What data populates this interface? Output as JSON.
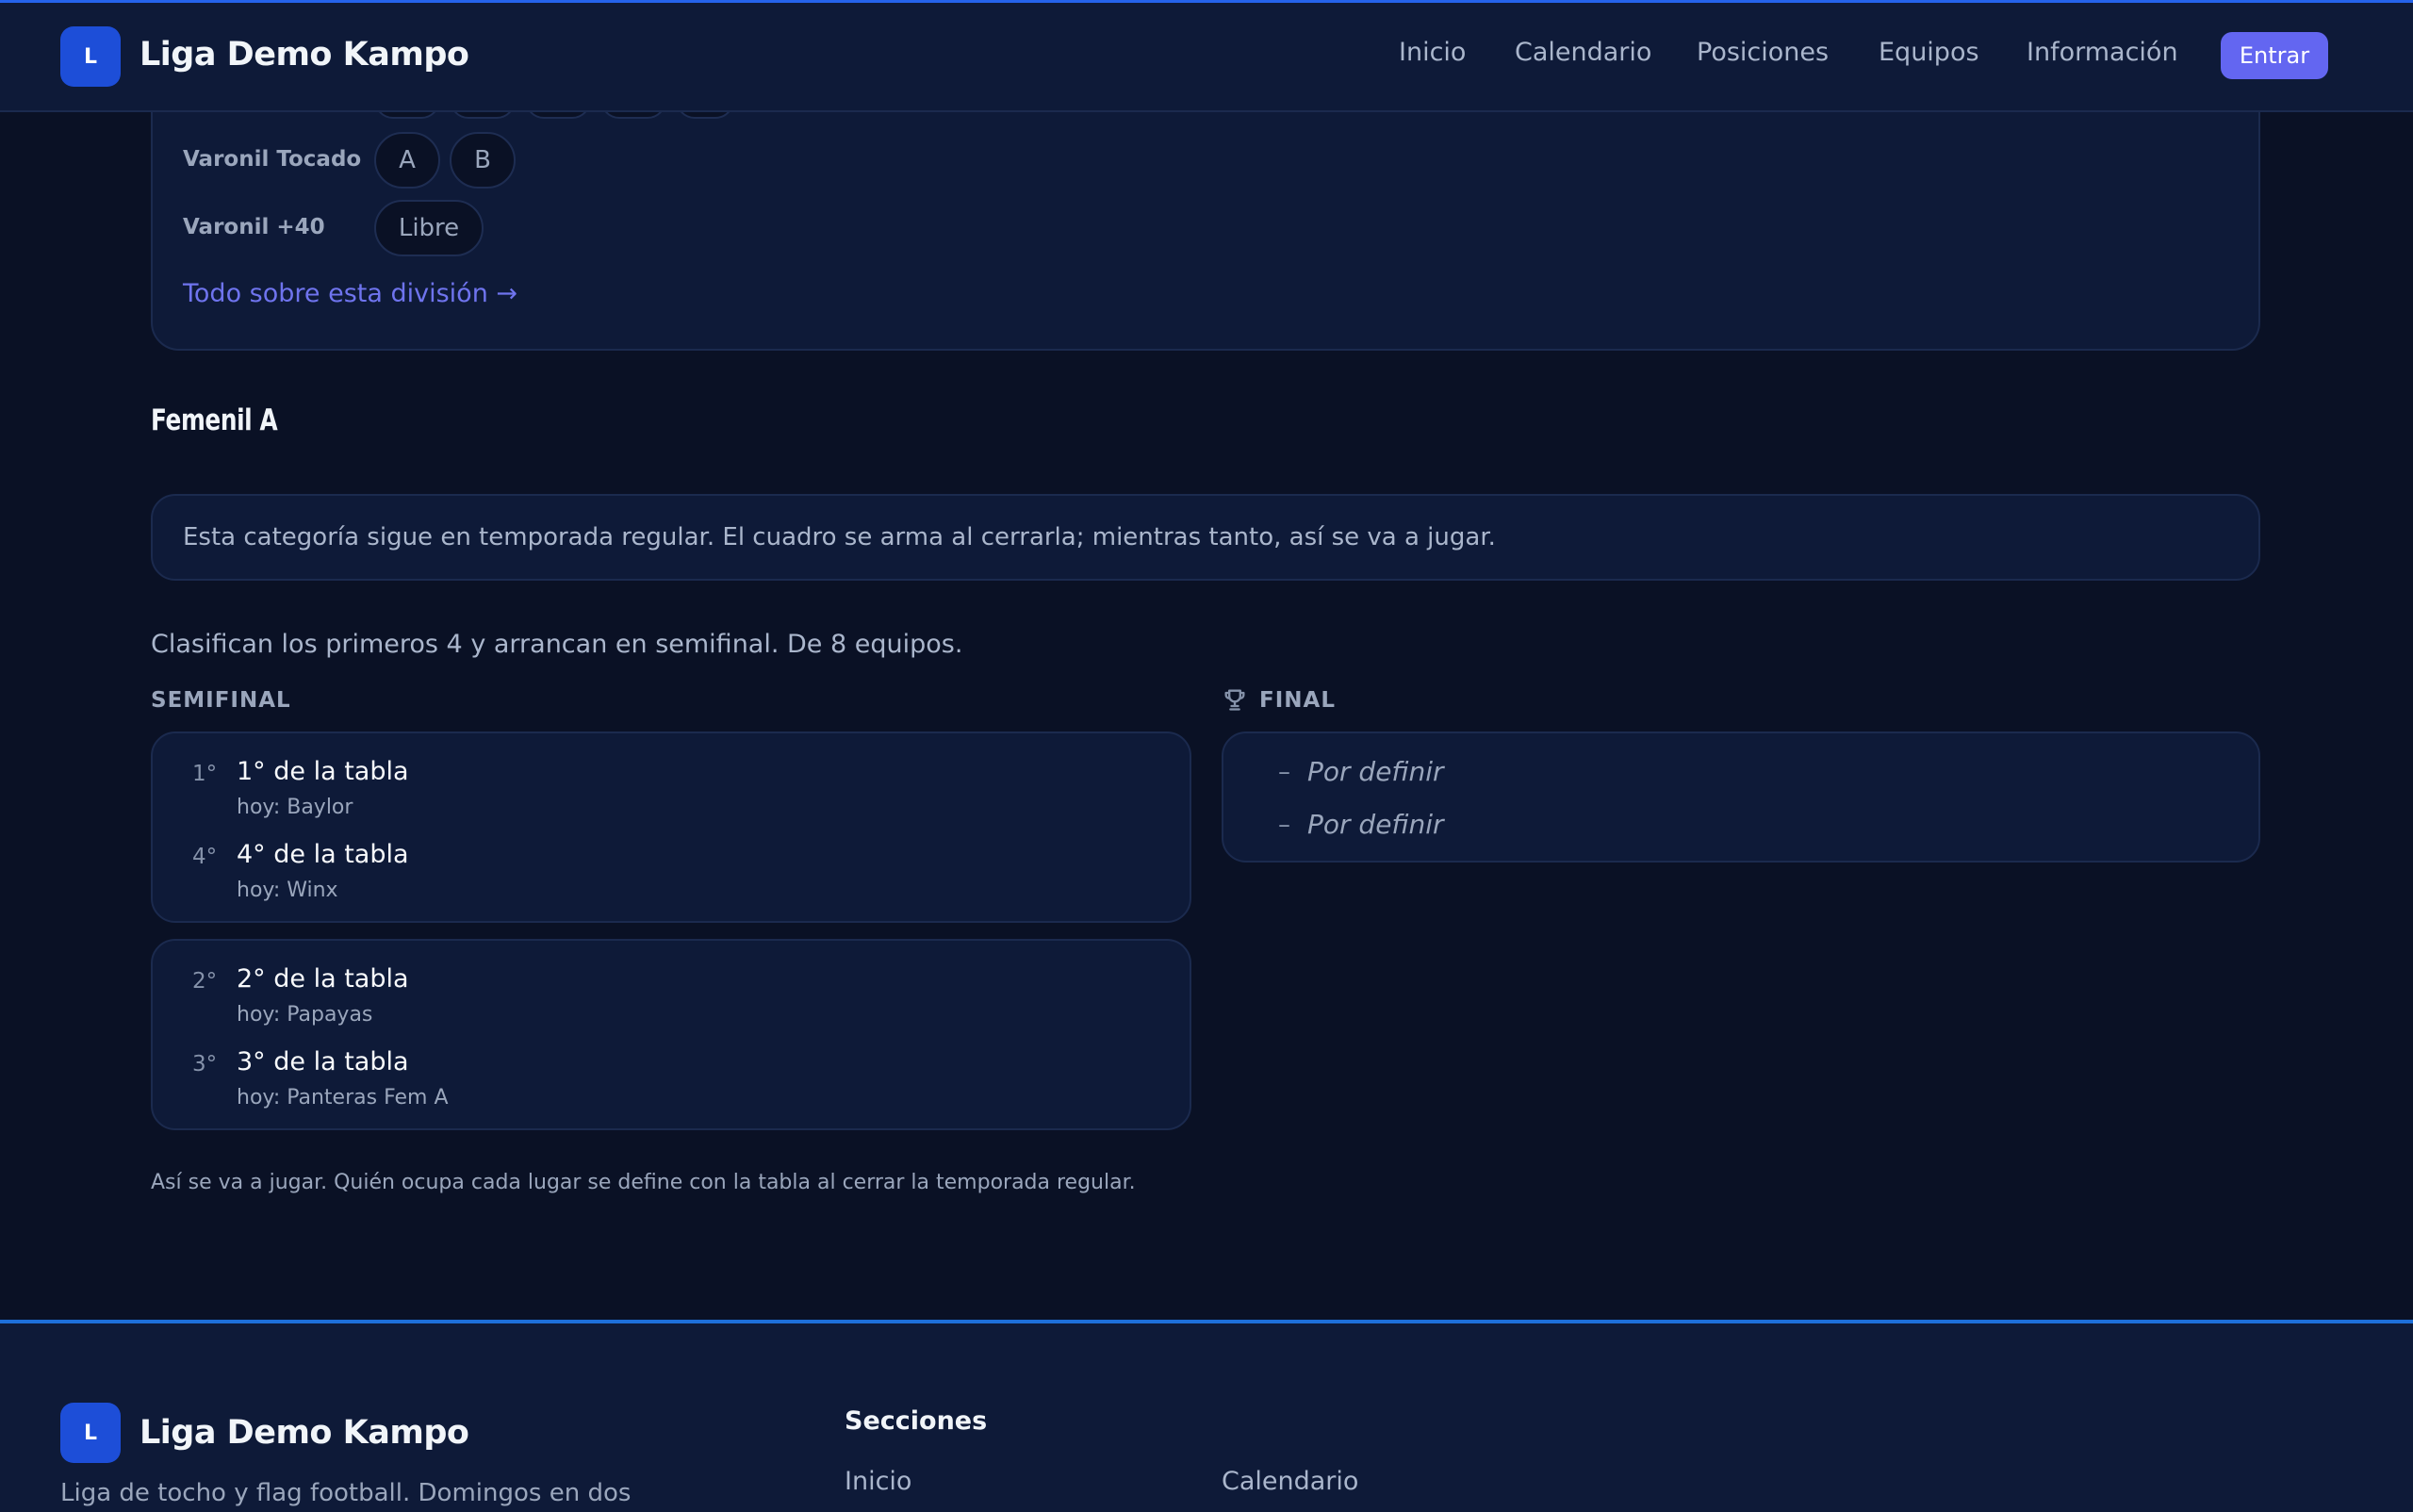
{
  "colors": {
    "background": "#0a1125",
    "surface": "#0e1a38",
    "accent": "#6366f1",
    "brand": "#1d4ed8",
    "link": "#6f74ee"
  },
  "nav": {
    "logo_letter": "L",
    "brand": "Liga Demo Kampo",
    "links": [
      "Inicio",
      "Calendario",
      "Posiciones",
      "Equipos",
      "Información"
    ],
    "login": "Entrar"
  },
  "divisions": {
    "rows": [
      {
        "label": "Varonil Tocado",
        "levels": [
          "A",
          "B"
        ]
      },
      {
        "label": "Varonil +40",
        "levels": [
          "Libre"
        ]
      }
    ],
    "link": "Todo sobre esta división →"
  },
  "category": {
    "title": "Femenil A",
    "notice": "Esta categoría sigue en temporada regular. El cuadro se arma al cerrarla; mientras tanto, así se va a jugar.",
    "summary": "Clasifican los primeros 4 y arrancan en semifinal. De 8 equipos.",
    "semifinal_label": "SEMIFINAL",
    "final_label": "FINAL",
    "trophy_icon": "trophy-icon",
    "semifinals": [
      [
        {
          "seed": "1°",
          "title": "1° de la tabla",
          "current": "hoy: Baylor"
        },
        {
          "seed": "4°",
          "title": "4° de la tabla",
          "current": "hoy: Winx"
        }
      ],
      [
        {
          "seed": "2°",
          "title": "2° de la tabla",
          "current": "hoy: Papayas"
        },
        {
          "seed": "3°",
          "title": "3° de la tabla",
          "current": "hoy: Panteras Fem A"
        }
      ]
    ],
    "final": [
      {
        "dash": "–",
        "label": "Por definir"
      },
      {
        "dash": "–",
        "label": "Por definir"
      }
    ],
    "note": "Así se va a jugar. Quién ocupa cada lugar se define con la tabla al cerrar la temporada regular."
  },
  "footer": {
    "logo_letter": "L",
    "brand": "Liga Demo Kampo",
    "description": "Liga de tocho y flag football. Domingos en dos",
    "sections_title": "Secciones",
    "links": [
      "Inicio",
      "Calendario"
    ]
  }
}
